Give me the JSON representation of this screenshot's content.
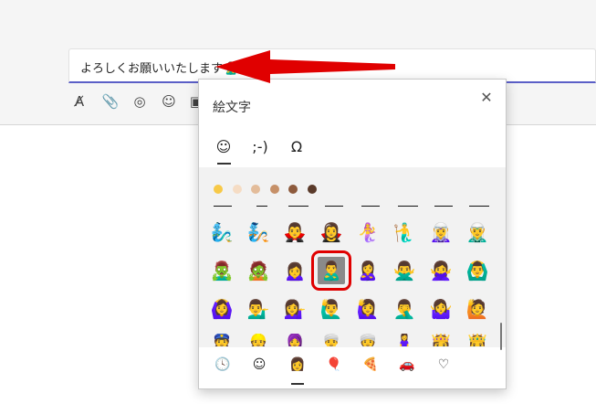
{
  "compose": {
    "text": "よろしくお願いいたします",
    "inserted_emoji": "🙎‍♂️"
  },
  "toolbar": {
    "icons": [
      "format-icon",
      "attach-icon",
      "loop-icon",
      "emoji-icon",
      "gif-icon"
    ],
    "glyphs": [
      "A̸",
      "📎",
      "◎",
      "☺",
      "▣"
    ]
  },
  "emoji_panel": {
    "title": "絵文字",
    "close_glyph": "✕",
    "category_tabs": [
      {
        "name": "emoji",
        "glyph": "☺"
      },
      {
        "name": "kaomoji",
        "glyph": ";-)"
      },
      {
        "name": "symbols",
        "glyph": "Ω"
      }
    ],
    "skin_tones": [
      "#f7c948",
      "#f5dcc4",
      "#e3bc9a",
      "#c69068",
      "#8d5a3c",
      "#5a3a2a"
    ],
    "rows": [
      [
        "🧞‍♂️",
        "🧞",
        "🧛‍♂️",
        "🧛‍♀️",
        "🧜‍♀️",
        "🧜‍♂️",
        "🧝‍♀️",
        "🧝‍♂️"
      ],
      [
        "🧟‍♂️",
        "🧟",
        "🙍‍♀️",
        "🙎‍♂️",
        "🙎‍♀️",
        "🙅‍♂️",
        "🙅‍♀️",
        "🙆‍♂️"
      ],
      [
        "🙆‍♀️",
        "💁‍♂️",
        "💁‍♀️",
        "🙋‍♂️",
        "🙋‍♀️",
        "🤦‍♂️",
        "🤷‍♀️",
        "🙋"
      ],
      [
        "👮",
        "👷",
        "🧕",
        "👳‍♂️",
        "👳‍♀️",
        "🧘‍♀️",
        "👸",
        "🤴"
      ]
    ],
    "selected": "🙎‍♂️",
    "bottom_tabs": [
      {
        "name": "recent-icon",
        "glyph": "🕓"
      },
      {
        "name": "smileys-icon",
        "glyph": "☺"
      },
      {
        "name": "people-icon",
        "glyph": "👩"
      },
      {
        "name": "celebration-icon",
        "glyph": "🎈"
      },
      {
        "name": "food-icon",
        "glyph": "🍕"
      },
      {
        "name": "travel-icon",
        "glyph": "🚗"
      },
      {
        "name": "heart-icon",
        "glyph": "♡"
      }
    ]
  },
  "colors": {
    "accent": "#5b5fc7",
    "highlight": "#e00000"
  }
}
